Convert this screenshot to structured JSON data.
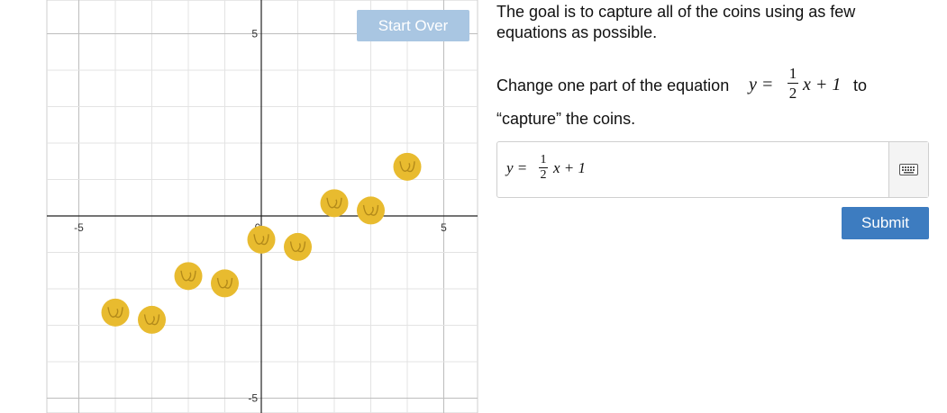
{
  "graph": {
    "x_range": [
      -5.9,
      5.9
    ],
    "y_range": [
      -5.5,
      5.9
    ],
    "x_tick_labels": [
      "-5",
      "0",
      "5"
    ],
    "y_tick_labels": [
      "5",
      "-5"
    ],
    "coins": [
      {
        "x": -4,
        "y": -2.65
      },
      {
        "x": -3,
        "y": -2.85
      },
      {
        "x": -2,
        "y": -1.65
      },
      {
        "x": -1,
        "y": -1.85
      },
      {
        "x": 0,
        "y": -0.65
      },
      {
        "x": 1,
        "y": -0.85
      },
      {
        "x": 2,
        "y": 0.35
      },
      {
        "x": 3,
        "y": 0.15
      },
      {
        "x": 4,
        "y": 1.35
      }
    ],
    "coin_color": "#e8bb2f"
  },
  "start_over_label": "Start Over",
  "instructions": {
    "goal": "The goal is to capture all of the coins using as few equations as possible.",
    "change_prefix": "Change one part of the equation",
    "change_suffix": "to",
    "capture_line": "“capture” the coins."
  },
  "equation": {
    "lhs": "y =",
    "frac_num": "1",
    "frac_den": "2",
    "rhs": "x + 1"
  },
  "keypad_icon": "keyboard-icon",
  "submit_label": "Submit",
  "colors": {
    "accent": "#3d7cc0",
    "start_over": "#a9c6e2",
    "coin": "#e8bb2f"
  }
}
